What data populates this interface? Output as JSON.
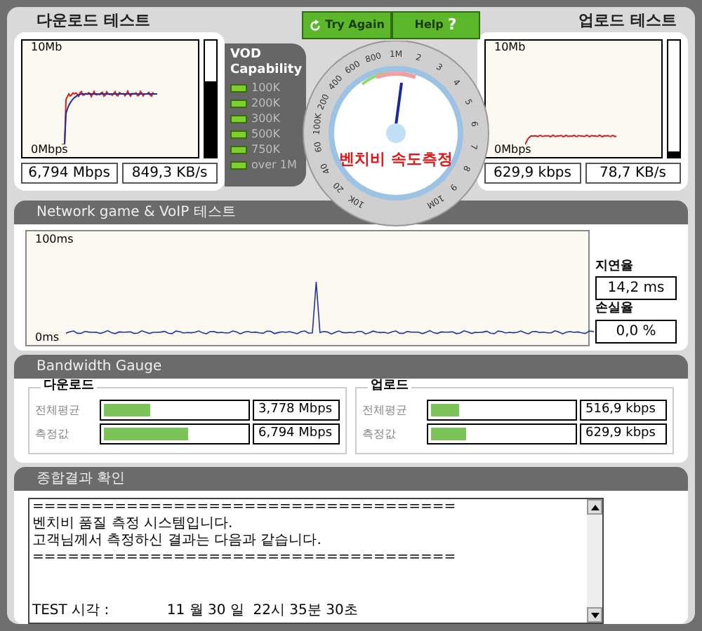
{
  "download_test": {
    "title": "다운로드 테스트",
    "y_max": "10Mb",
    "y_min": "0Mbps",
    "level": 0.65,
    "speed": "6,794 Mbps",
    "rate": "849,3 KB/s"
  },
  "vod": {
    "title": "VOD Capability",
    "items": [
      {
        "label": "100K",
        "on": true
      },
      {
        "label": "200K",
        "on": true
      },
      {
        "label": "300K",
        "on": true
      },
      {
        "label": "500K",
        "on": true
      },
      {
        "label": "750K",
        "on": true
      },
      {
        "label": "over 1M",
        "on": true
      }
    ]
  },
  "buttons": [
    {
      "label": "Try Again",
      "kind": "retry"
    },
    {
      "label": "Help",
      "kind": "help",
      "icon_text": "?"
    }
  ],
  "dial": {
    "title": "벤치비 속도측정",
    "scale": [
      "10K",
      "20",
      "40",
      "60",
      "100K",
      "200",
      "400",
      "600",
      "800",
      "1M",
      "2",
      "3",
      "4",
      "5",
      "6",
      "7",
      "8",
      "9",
      "10M"
    ]
  },
  "upload_test": {
    "title": "업로드 테스트",
    "y_max": "10Mb",
    "y_min": "0Mbps",
    "level": 0.05,
    "speed": "629,9 kbps",
    "rate": "78,7 KB/s"
  },
  "network": {
    "title": "Network game & VoIP 테스트",
    "y_max": "100ms",
    "y_min": "0ms",
    "latency_label": "지연율",
    "latency": "14,2 ms",
    "loss_label": "손실율",
    "loss": "0,0 %"
  },
  "bandwidth": {
    "title": "Bandwidth Gauge",
    "groups": [
      {
        "title": "다운로드",
        "rows": [
          {
            "label": "전체평균",
            "level": 0.33,
            "value": "3,778 Mbps"
          },
          {
            "label": "측정값",
            "level": 0.59,
            "value": "6,794 Mbps"
          }
        ]
      },
      {
        "title": "업로드",
        "rows": [
          {
            "label": "전체평균",
            "level": 0.2,
            "value": "516,9 kbps"
          },
          {
            "label": "측정값",
            "level": 0.25,
            "value": "629,9 kbps"
          }
        ]
      }
    ]
  },
  "summary": {
    "title": "종합결과 확인",
    "header_lines": [
      "====================================",
      "벤치비 품질 측정 시스템입니다.",
      "고객님께서 측정하신 결과는 다음과 같습니다.",
      "===================================="
    ],
    "detail_lines": [
      "TEST 시각 :             11 월 30 일  22시 35분 30초"
    ]
  }
}
